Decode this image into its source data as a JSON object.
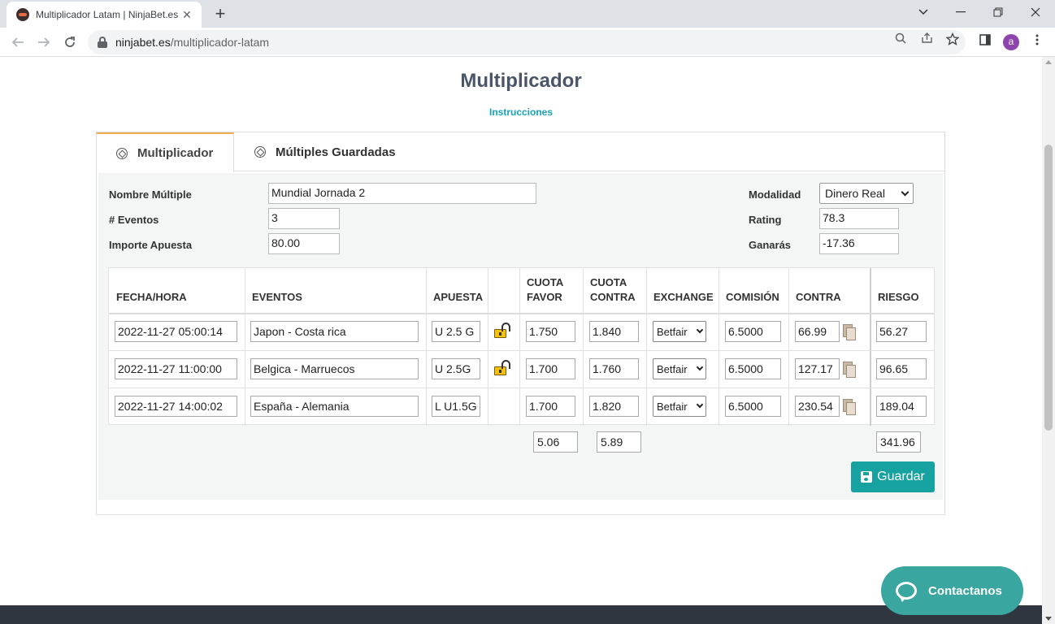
{
  "browser": {
    "tab_title": "Multiplicador Latam | NinjaBet.es",
    "tab_close": "✕",
    "new_tab": "+",
    "url_domain": "ninjabet.es",
    "url_path": "/multiplicador-latam",
    "avatar_letter": "a"
  },
  "page": {
    "title": "Multiplicador",
    "instructions_link": "Instrucciones"
  },
  "tabs": [
    {
      "label": "Multiplicador",
      "active": true
    },
    {
      "label": "Múltiples Guardadas",
      "active": false
    }
  ],
  "form": {
    "nombre_label": "Nombre Múltiple",
    "nombre_value": "Mundial Jornada 2",
    "eventos_label": "# Eventos",
    "eventos_value": "3",
    "importe_label": "Importe Apuesta",
    "importe_value": "80.00",
    "modalidad_label": "Modalidad",
    "modalidad_value": "Dinero Real",
    "rating_label": "Rating",
    "rating_value": "78.3",
    "ganaras_label": "Ganarás",
    "ganaras_value": "-17.36"
  },
  "table": {
    "headers": {
      "fecha": "FECHA/HORA",
      "eventos": "EVENTOS",
      "apuesta": "APUESTA",
      "cuota_favor_1": "CUOTA",
      "cuota_favor_2": "FAVOR",
      "cuota_contra_1": "CUOTA",
      "cuota_contra_2": "CONTRA",
      "exchange": "EXCHANGE",
      "comision": "COMISIÓN",
      "contra": "CONTRA",
      "riesgo": "RIESGO"
    },
    "rows": [
      {
        "fecha": "2022-11-27 05:00:14",
        "evento": "Japon - Costa rica",
        "apuesta": "U 2.5 G",
        "locked": true,
        "cuota_favor": "1.750",
        "cuota_contra": "1.840",
        "exchange": "Betfair",
        "comision": "6.5000",
        "contra": "66.99",
        "riesgo": "56.27"
      },
      {
        "fecha": "2022-11-27 11:00:00",
        "evento": "Belgica - Marruecos",
        "apuesta": "U 2.5G",
        "locked": true,
        "cuota_favor": "1.700",
        "cuota_contra": "1.760",
        "exchange": "Betfair",
        "comision": "6.5000",
        "contra": "127.17",
        "riesgo": "96.65"
      },
      {
        "fecha": "2022-11-27 14:00:02",
        "evento": "España - Alemania",
        "apuesta": "L U1.5G",
        "locked": false,
        "cuota_favor": "1.700",
        "cuota_contra": "1.820",
        "exchange": "Betfair",
        "comision": "6.5000",
        "contra": "230.54",
        "riesgo": "189.04"
      }
    ],
    "totals": {
      "cuota_favor": "5.06",
      "cuota_contra": "5.89",
      "riesgo": "341.96"
    }
  },
  "buttons": {
    "save": "Guardar",
    "contact": "Contactanos"
  },
  "colors": {
    "accent_teal": "#17a2a2",
    "active_tab_border": "#f0ad4e",
    "title": "#4a5568"
  }
}
